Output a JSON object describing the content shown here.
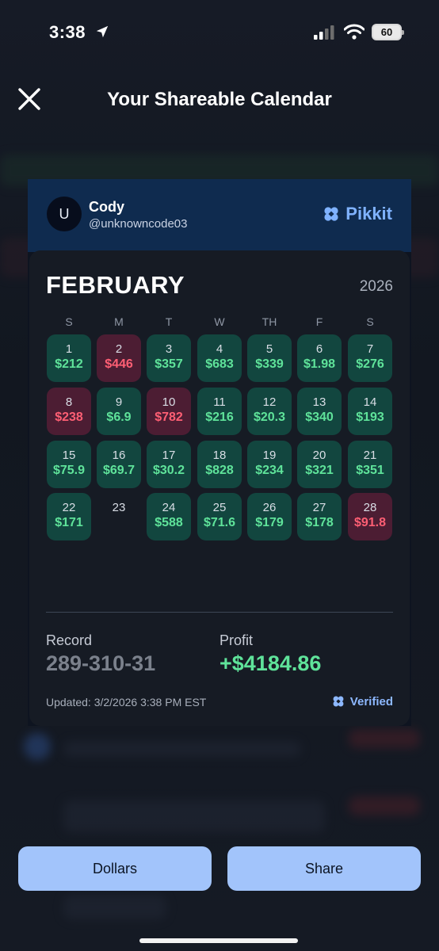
{
  "status_bar": {
    "time": "3:38",
    "battery": "60"
  },
  "header": {
    "title": "Your Shareable Calendar"
  },
  "profile": {
    "avatar_letter": "U",
    "name": "Cody",
    "handle": "@unknowncode03"
  },
  "brand": {
    "name": "Pikkit",
    "color": "#7fb2ff"
  },
  "calendar": {
    "month": "FEBRUARY",
    "year": "2026",
    "weekdays": [
      "S",
      "M",
      "T",
      "W",
      "TH",
      "F",
      "S"
    ],
    "days": [
      {
        "day": "1",
        "amount": "$212",
        "result": "win"
      },
      {
        "day": "2",
        "amount": "$446",
        "result": "loss"
      },
      {
        "day": "3",
        "amount": "$357",
        "result": "win"
      },
      {
        "day": "4",
        "amount": "$683",
        "result": "win"
      },
      {
        "day": "5",
        "amount": "$339",
        "result": "win"
      },
      {
        "day": "6",
        "amount": "$1.98",
        "result": "win"
      },
      {
        "day": "7",
        "amount": "$276",
        "result": "win"
      },
      {
        "day": "8",
        "amount": "$238",
        "result": "loss"
      },
      {
        "day": "9",
        "amount": "$6.9",
        "result": "win"
      },
      {
        "day": "10",
        "amount": "$782",
        "result": "loss"
      },
      {
        "day": "11",
        "amount": "$216",
        "result": "win"
      },
      {
        "day": "12",
        "amount": "$20.3",
        "result": "win"
      },
      {
        "day": "13",
        "amount": "$340",
        "result": "win"
      },
      {
        "day": "14",
        "amount": "$193",
        "result": "win"
      },
      {
        "day": "15",
        "amount": "$75.9",
        "result": "win"
      },
      {
        "day": "16",
        "amount": "$69.7",
        "result": "win"
      },
      {
        "day": "17",
        "amount": "$30.2",
        "result": "win"
      },
      {
        "day": "18",
        "amount": "$828",
        "result": "win"
      },
      {
        "day": "19",
        "amount": "$234",
        "result": "win"
      },
      {
        "day": "20",
        "amount": "$321",
        "result": "win"
      },
      {
        "day": "21",
        "amount": "$351",
        "result": "win"
      },
      {
        "day": "22",
        "amount": "$171",
        "result": "win"
      },
      {
        "day": "23",
        "amount": "",
        "result": "none"
      },
      {
        "day": "24",
        "amount": "$588",
        "result": "win"
      },
      {
        "day": "25",
        "amount": "$71.6",
        "result": "win"
      },
      {
        "day": "26",
        "amount": "$179",
        "result": "win"
      },
      {
        "day": "27",
        "amount": "$178",
        "result": "win"
      },
      {
        "day": "28",
        "amount": "$91.8",
        "result": "loss"
      }
    ]
  },
  "summary": {
    "record_label": "Record",
    "record_value": "289-310-31",
    "profit_label": "Profit",
    "profit_value": "+$4184.86",
    "updated": "Updated: 3/2/2026 3:38 PM EST",
    "verified": "Verified"
  },
  "buttons": {
    "dollars": "Dollars",
    "share": "Share"
  },
  "colors": {
    "win_bg": "#12463f",
    "loss_bg": "#4c1d33",
    "win_text": "#5fe39a",
    "loss_text": "#ff5f74",
    "button_bg": "#a2c4fb"
  }
}
